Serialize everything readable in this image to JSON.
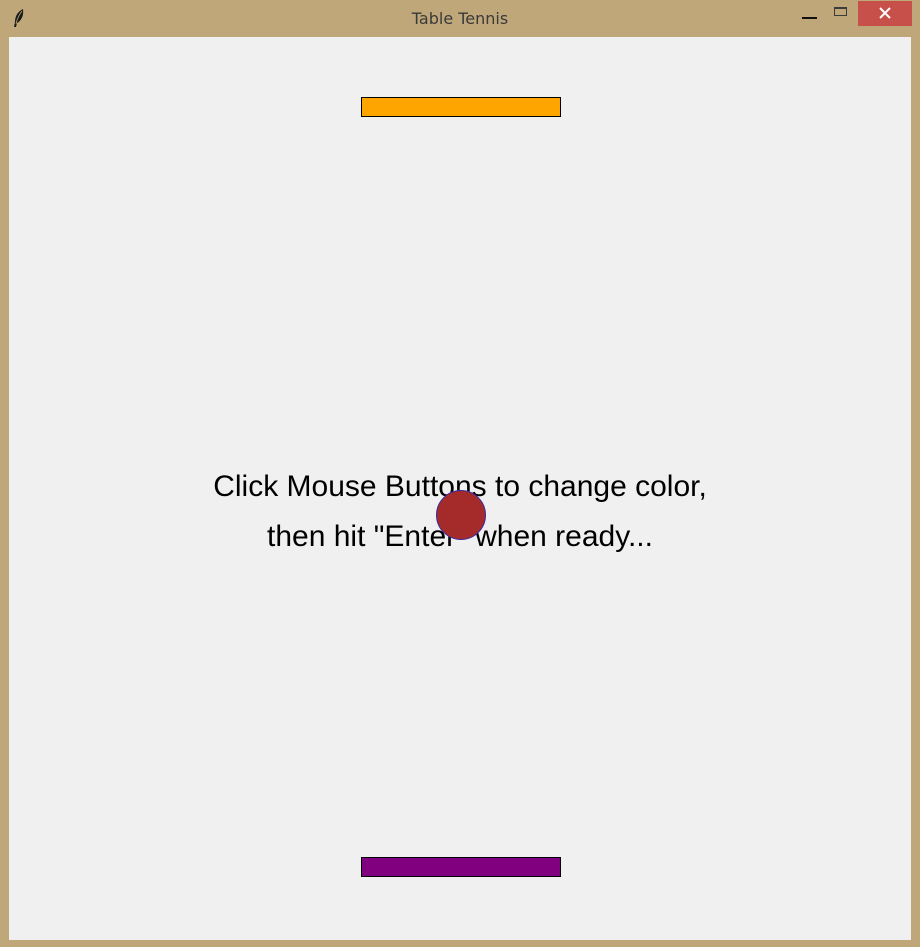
{
  "window": {
    "title": "Table Tennis",
    "icon": "feather-icon",
    "controls": {
      "minimize": "minimize-icon",
      "maximize": "maximize-icon",
      "close": "close-icon"
    }
  },
  "game": {
    "message_line1": "Click Mouse Buttons to change color,",
    "message_line2": "then hit \"Enter\" when ready...",
    "top_paddle_color": "#ffa500",
    "bottom_paddle_color": "#800080",
    "ball_color": "#a52a2a",
    "ball_outline_color": "#3a2aa0",
    "canvas_background": "#f0f0f0"
  }
}
